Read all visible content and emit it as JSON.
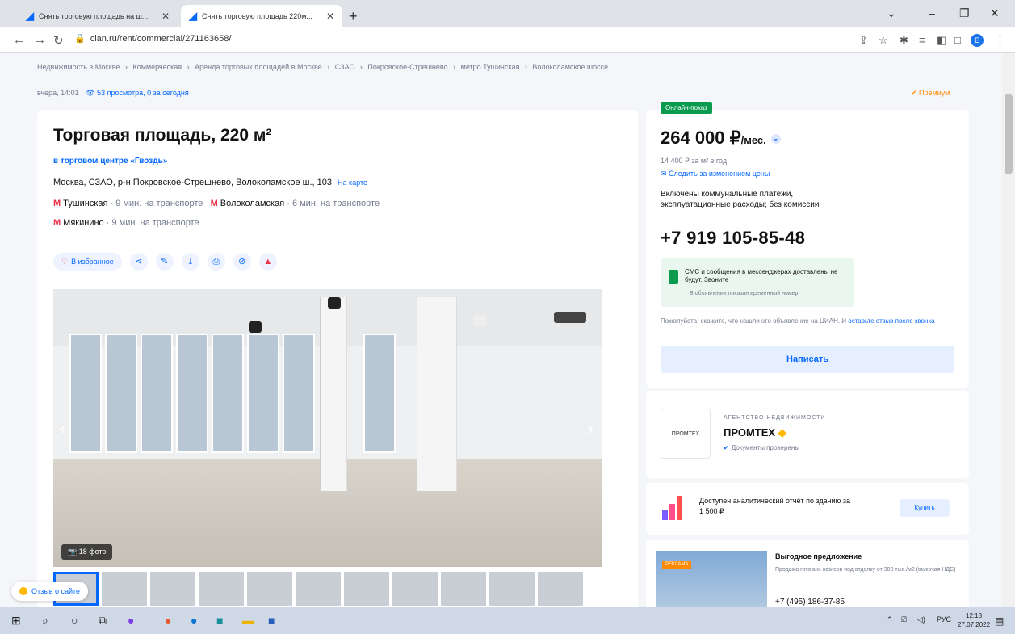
{
  "browser": {
    "tabs": [
      {
        "label": "Снять торговую площадь на ш..."
      },
      {
        "label": "Снять торговую площадь 220м..."
      }
    ],
    "url": "cian.ru/rent/commercial/271163658/"
  },
  "breadcrumbs": [
    "Недвижимость в Москве",
    "›",
    "Коммерческая",
    "›",
    "Аренда торговых площадей в Москве",
    "›",
    "СЗАО",
    "›",
    "Покровское-Стрешнево",
    "›",
    "метро Тушинская",
    "›",
    "Волоколамское шоссе"
  ],
  "meta": {
    "date": "вчера, 14:01",
    "views": "53 просмотра, 0 за сегодня",
    "premium": "Премиум"
  },
  "listing": {
    "title": "Торговая площадь, 220 м²",
    "mall": "в торговом центре «Гвоздь»",
    "address": "Москва, СЗАО, р-н Покровское-Стрешнево, Волоколамское ш., 103",
    "map_link": "На карте",
    "metro": [
      {
        "station": "Тушинская",
        "time": "· 9 мин. на транспорте"
      },
      {
        "station": "Волоколамская",
        "time": "· 6 мин. на транспорте"
      },
      {
        "station": "Мякинино",
        "time": "· 9 мин. на транспорте"
      }
    ],
    "favorite_label": "В избранное",
    "photo_count": "18 фото"
  },
  "price": {
    "online_badge": "Онлайн-показ",
    "amount": "264 000 ₽",
    "period": "/мес.",
    "per_sqm": "14 400 ₽ за м² в год",
    "follow": "Следить за изменением цены",
    "includes": "Включены коммунальные платежи, эксплуатационные расходы; без комиссии",
    "phone": "+7 919 105-85-48",
    "sms_note": "СМС и сообщения в мессенджерах доставлены не будут. Звоните",
    "temp_number": "В объявлении показан временный номер",
    "please_text": "Пожалуйста, скажите, что нашли это объявление на ЦИАН. И",
    "please_link": "оставьте отзыв после звонка",
    "write_label": "Написать"
  },
  "agency": {
    "kind": "АГЕНТСТВО НЕДВИЖИМОСТИ",
    "name": "ПРОМТЕХ",
    "docs": "Документы проверены",
    "logo_text": "ПРОМТЕХ"
  },
  "report": {
    "text": "Доступен аналитический отчёт по зданию за 1 500 ₽",
    "buy_label": "Купить"
  },
  "offer": {
    "badge": "РЕКЛАМА",
    "title": "Выгодное предложение",
    "desc": "Продажа готовых офисов под отделку от 300 тыс./м2 (включая НДС)",
    "phone": "+7 (495) 186-37-85"
  },
  "feedback_label": "Отзыв о сайте",
  "taskbar": {
    "lang": "РУС",
    "time": "12:18",
    "date": "27.07.2022"
  },
  "colors": {
    "accent": "#0468ff",
    "metro": "#e8334a",
    "online": "#0a9b4f",
    "premium": "#ff8a00"
  }
}
